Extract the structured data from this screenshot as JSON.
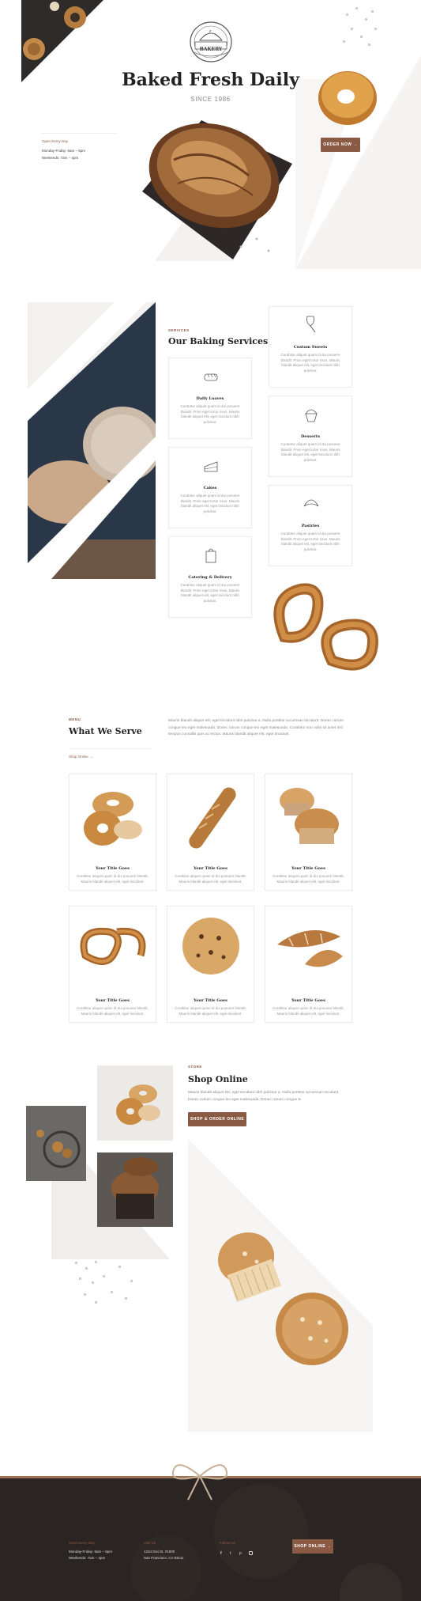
{
  "hero": {
    "title": "Baked Fresh Daily",
    "since": "SINCE 1986",
    "logo_text": "BAKERY",
    "hours_label": "Open Every Day",
    "hours_weekday": "Monday-Friday: 6am – 5pm",
    "hours_weekend": "Weekends: 7am – 4pm",
    "order_button": "ORDER NOW →"
  },
  "services": {
    "eyebrow": "SERVICES",
    "title": "Our Baking Services",
    "items": [
      {
        "title": "Daily Loaves",
        "text": "Curabitur aliquet quam id dui posuere blandit. Proin eget tortor risus. Mauris blandit aliquet elit, eget tincidunt nibh pulvinar.",
        "icon": "bread-loaf-icon"
      },
      {
        "title": "Cakes",
        "text": "Curabitur aliquet quam id dui posuere blandit. Proin eget tortor risus. Mauris blandit aliquet elit, eget tincidunt nibh pulvinar.",
        "icon": "cake-slice-icon"
      },
      {
        "title": "Catering & Delivery",
        "text": "Curabitur aliquet quam id dui posuere blandit. Proin eget tortor risus. Mauris blandit aliquet elit, eget tincidunt nibh pulvinar.",
        "icon": "bag-icon"
      },
      {
        "title": "Custom Sweets",
        "text": "Curabitur aliquet quam id dui posuere blandit. Proin eget tortor risus. Mauris blandit aliquet elit, eget tincidunt nibh pulvinar.",
        "icon": "whisk-icon"
      },
      {
        "title": "Desserts",
        "text": "Curabitur aliquet quam id dui posuere blandit. Proin eget tortor risus. Mauris blandit aliquet elit, eget tincidunt nibh pulvinar.",
        "icon": "cupcake-icon"
      },
      {
        "title": "Pastries",
        "text": "Curabitur aliquet quam id dui posuere blandit. Proin eget tortor risus. Mauris blandit aliquet elit, eget tincidunt nibh pulvinar.",
        "icon": "croissant-icon"
      }
    ]
  },
  "menu": {
    "eyebrow": "MENU",
    "title": "What We Serve",
    "link": "Shop Online →",
    "intro": "Mauris blandit aliquet elit, eget tincidunt nibh pulvinar a. Nulla porttitor accumsan tincidunt. Donec rutrum congue leo eget malesuada. Donec rutrum congue leo eget malesuada. Curabitur non nulla sit amet nisl tempus convallis quis ac lectus. Mauris blandit aliquet elit, eget tincidunt.",
    "items": [
      {
        "title": "Your Title Goes",
        "text": "Curabitur aliquet quam id dui posuere blandit. Mauris blandit aliquet elit, eget tincidunt.",
        "icon": "bagels-icon"
      },
      {
        "title": "Your Title Goes",
        "text": "Curabitur aliquet quam id dui posuere blandit. Mauris blandit aliquet elit, eget tincidunt.",
        "icon": "baguette-icon"
      },
      {
        "title": "Your Title Goes",
        "text": "Curabitur aliquet quam id dui posuere blandit. Mauris blandit aliquet elit, eget tincidunt.",
        "icon": "muffins-icon"
      },
      {
        "title": "Your Title Goes",
        "text": "Curabitur aliquet quam id dui posuere blandit. Mauris blandit aliquet elit, eget tincidunt.",
        "icon": "pretzel-icon"
      },
      {
        "title": "Your Title Goes",
        "text": "Curabitur aliquet quam id dui posuere blandit. Mauris blandit aliquet elit, eget tincidunt.",
        "icon": "cookie-icon"
      },
      {
        "title": "Your Title Goes",
        "text": "Curabitur aliquet quam id dui posuere blandit. Mauris blandit aliquet elit, eget tincidunt.",
        "icon": "croissants-icon"
      }
    ]
  },
  "store": {
    "eyebrow": "STORE",
    "title": "Shop Online",
    "text": "Mauris blandit aliquet elit, eget tincidunt nibh pulvinar a. Nulla porttitor accumsan tincidunt. Donec rutrum congue leo eget malesuada. Donec rutrum congue le",
    "button": "SHOP & ORDER ONLINE →"
  },
  "footer": {
    "col1_label": "Open Every Day",
    "col1_line1": "Monday-Friday: 6am – 5pm",
    "col1_line2": "Weekends: 7am – 4pm",
    "col2_label": "Visit Us",
    "col2_line1": "1234 Divi St. #1000",
    "col2_line2": "San Francisco, CA 93111",
    "col3_label": "Follow Us",
    "social_icons": [
      "facebook-icon",
      "twitter-icon",
      "pinterest-icon",
      "instagram-icon"
    ],
    "button": "SHOP ONLINE →"
  },
  "colors": {
    "accent": "#8b5a44",
    "footer_bg": "#2a2523",
    "light_gray": "#f2f1ef"
  }
}
